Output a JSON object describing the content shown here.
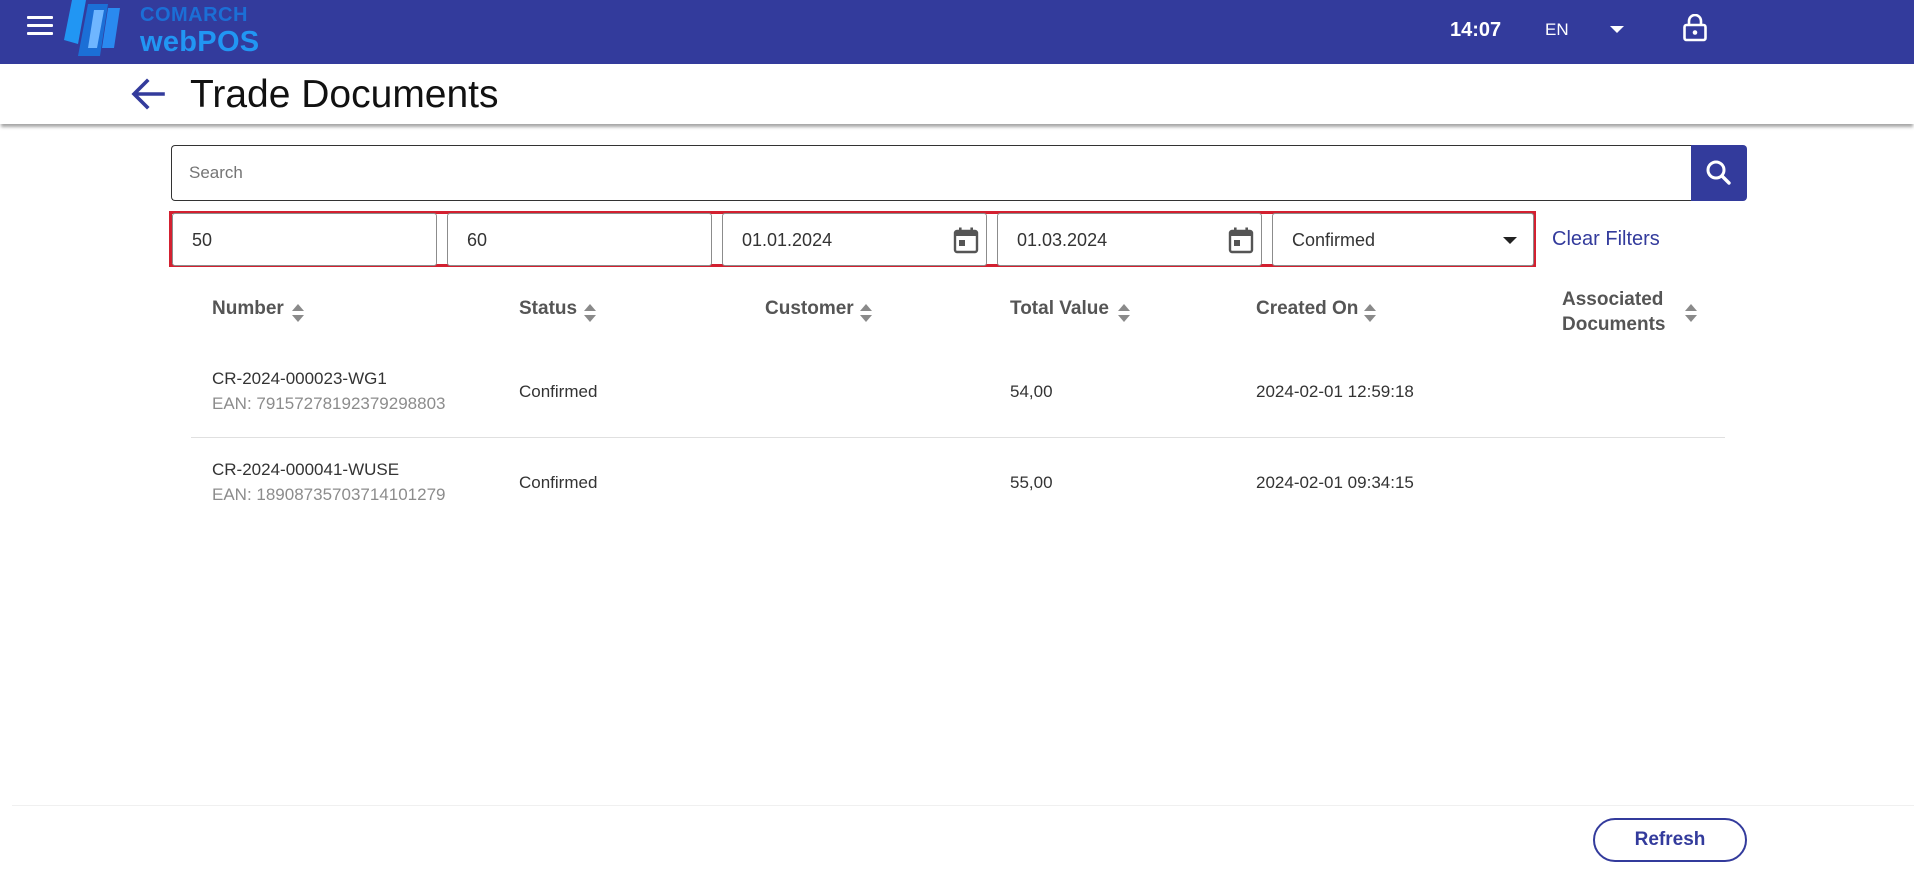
{
  "topbar": {
    "logo_top": "COMARCH",
    "logo_bottom": "webPOS",
    "time": "14:07",
    "language": "EN",
    "icons": [
      "menu-icon",
      "chevron-down-icon",
      "lock-icon"
    ],
    "color": "#333b9c"
  },
  "header": {
    "title": "Trade Documents",
    "icons": [
      "back-arrow-icon"
    ]
  },
  "search": {
    "placeholder": "Search",
    "value": "",
    "icons": [
      "search-icon"
    ]
  },
  "filters": {
    "value_from": "50",
    "value_to": "60",
    "date_from": "01.01.2024",
    "date_to": "01.03.2024",
    "status": "Confirmed",
    "clear_label": "Clear Filters",
    "highlight_color": "#d32030"
  },
  "table": {
    "columns": {
      "number": "Number",
      "status": "Status",
      "customer": "Customer",
      "total_value": "Total Value",
      "created_on": "Created On",
      "associated_line1": "Associated",
      "associated_line2": "Documents"
    },
    "rows": [
      {
        "number": "CR-2024-000023-WG1",
        "ean": "EAN: 79157278192379298803",
        "status": "Confirmed",
        "customer": "",
        "total_value": "54,00",
        "created_on": "2024-02-01 12:59:18",
        "associated": ""
      },
      {
        "number": "CR-2024-000041-WUSE",
        "ean": "EAN: 18908735703714101279",
        "status": "Confirmed",
        "customer": "",
        "total_value": "55,00",
        "created_on": "2024-02-01 09:34:15",
        "associated": ""
      }
    ]
  },
  "footer": {
    "refresh_label": "Refresh"
  }
}
